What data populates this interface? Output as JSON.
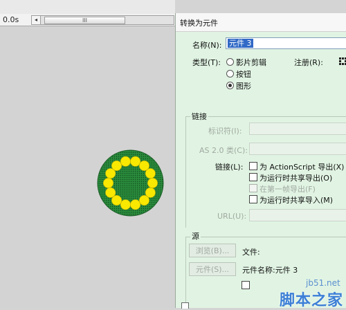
{
  "timeline": {
    "time": "0.0s",
    "scroll_left_arrow": "◂",
    "scroll_grip": "III"
  },
  "dialog": {
    "title": "转换为元件",
    "name_label": "名称(N):",
    "name_value": "元件 3",
    "type_label": "类型(T):",
    "types": [
      "影片剪辑",
      "按钮",
      "图形"
    ],
    "selected_type": "图形",
    "registration_label": "注册(R):",
    "linkage": {
      "section_title": "链接",
      "identifier_label": "标识符(I):",
      "as2_class_label": "AS 2.0 类(C):",
      "linkage_label": "链接(L):",
      "options": [
        "为 ActionScript 导出(X)",
        "为运行时共享导出(O)",
        "在第一帧导出(F)",
        "为运行时共享导入(M)"
      ],
      "url_label": "URL(U):"
    },
    "source": {
      "section_title": "源",
      "browse_button": "浏览(B)...",
      "file_label": "文件:",
      "symbol_button": "元件(S)...",
      "symbol_name_label": "元件名称:元件 3"
    }
  },
  "watermark": {
    "site": "jb51.net",
    "brand": "脚本之家"
  },
  "colors": {
    "dialog_bg": "#e1f4e3",
    "stage_bg": "#d3d3d3",
    "selection": "#3169c6",
    "symbol_ring": "#2a8a3c",
    "symbol_dots": "#ffee00"
  }
}
